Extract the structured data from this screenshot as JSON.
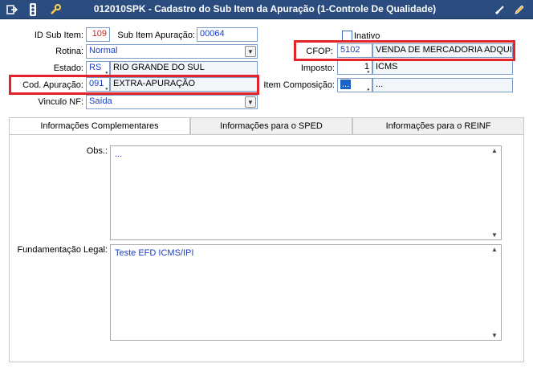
{
  "window": {
    "title": "012010SPK - Cadastro do Sub Item da Apuração (1-Controle De Qualidade)"
  },
  "icons": {
    "toolbar": [
      "exit-icon",
      "traffic-light-icon",
      "wrench-icon"
    ],
    "right": [
      "brush-icon",
      "pencil-icon"
    ]
  },
  "form": {
    "id_sub_item": {
      "label": "ID Sub Item:",
      "value": "109"
    },
    "sub_item_apuracao": {
      "label": "Sub Item Apuração:",
      "value": "00064"
    },
    "inativo": {
      "label": "Inativo",
      "checked": false
    },
    "rotina": {
      "label": "Rotina:",
      "value": "Normal"
    },
    "cfop": {
      "label": "CFOP:",
      "code": "5102",
      "description": "VENDA DE MERCADORIA ADQUIRID"
    },
    "estado": {
      "label": "Estado:",
      "code": "RS",
      "name": "RIO GRANDE DO SUL"
    },
    "imposto": {
      "label": "Imposto:",
      "code": "1",
      "name": "ICMS"
    },
    "cod_apuracao": {
      "label": "Cod. Apuração:",
      "code": "091",
      "description": "EXTRA-APURAÇÃO"
    },
    "item_composicao": {
      "label": "Item Composição:",
      "code": "...",
      "description": "..."
    },
    "vinculo_nf": {
      "label": "Vinculo NF:",
      "value": "Saída"
    }
  },
  "tabs": [
    {
      "label": "Informações Complementares",
      "active": true
    },
    {
      "label": "Informações para o SPED",
      "active": false
    },
    {
      "label": "Informações para o REINF",
      "active": false
    }
  ],
  "panel": {
    "obs": {
      "label": "Obs.:",
      "value": "..."
    },
    "fundamentacao": {
      "label": "Fundamentação Legal:",
      "value": "Teste EFD ICMS/IPI"
    }
  },
  "colors": {
    "titlebar": "#2b4c7e",
    "highlight": "#e2242a",
    "value_blue": "#1a3fbf",
    "value_red": "#d42020",
    "field_border": "#7a9cc9"
  }
}
